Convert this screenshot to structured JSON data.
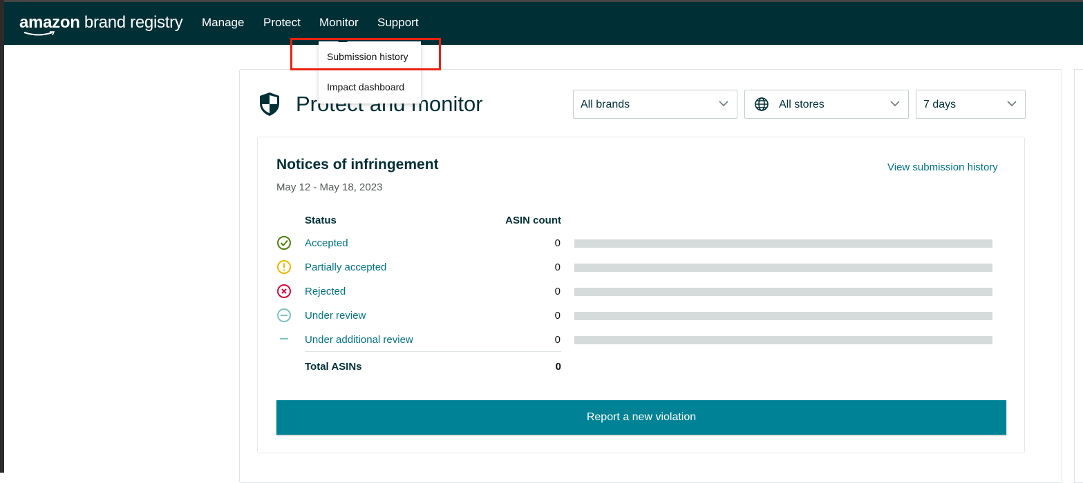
{
  "brand": {
    "logo_bold": "amazon",
    "logo_rest": " brand registry"
  },
  "nav": {
    "items": [
      "Manage",
      "Protect",
      "Monitor",
      "Support"
    ]
  },
  "monitor_menu": {
    "items": [
      "Submission history",
      "Impact dashboard"
    ],
    "highlighted": "Submission history"
  },
  "page": {
    "title": "Protect and monitor",
    "icon": "shield-icon"
  },
  "filters": {
    "brands": "All brands",
    "stores": "All stores",
    "period": "7 days"
  },
  "card": {
    "title": "Notices of infringement",
    "date_range": "May 12 - May 18, 2023",
    "view_link": "View submission history",
    "headers": {
      "status": "Status",
      "count": "ASIN count"
    },
    "rows": [
      {
        "label": "Accepted",
        "count": "0",
        "icon": "check-circle-icon",
        "color": "#4f7f0f"
      },
      {
        "label": "Partially accepted",
        "count": "0",
        "icon": "exclamation-circle-icon",
        "color": "#f2b600"
      },
      {
        "label": "Rejected",
        "count": "0",
        "icon": "x-circle-icon",
        "color": "#cc0c39"
      },
      {
        "label": "Under review",
        "count": "0",
        "icon": "minus-circle-icon",
        "color": "#7fc2bd"
      },
      {
        "label": "Under additional review",
        "count": "0",
        "icon": "dash-icon",
        "color": "#7fc2bd"
      }
    ],
    "total_label": "Total ASINs",
    "total_value": "0",
    "button": "Report a new violation"
  },
  "colors": {
    "nav": "#002f36",
    "accent": "#008296",
    "link": "#007185",
    "highlight": "#e8220e"
  }
}
